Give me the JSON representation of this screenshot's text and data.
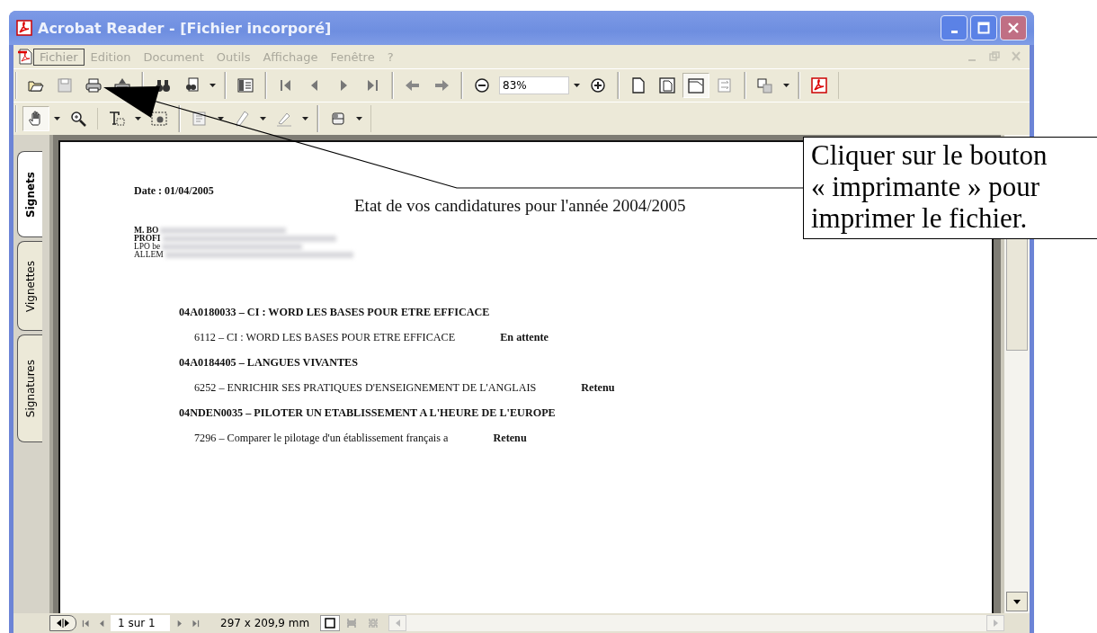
{
  "window": {
    "title": "Acrobat Reader - [Fichier incorporé]"
  },
  "menu": [
    {
      "label": "Fichier",
      "selected": true
    },
    {
      "label": "Edition",
      "selected": false
    },
    {
      "label": "Document",
      "selected": false
    },
    {
      "label": "Outils",
      "selected": false
    },
    {
      "label": "Affichage",
      "selected": false
    },
    {
      "label": "Fenêtre",
      "selected": false
    },
    {
      "label": "?",
      "selected": false
    }
  ],
  "zoom": {
    "value": "83%"
  },
  "page_layouts": [
    {
      "selected": false
    },
    {
      "selected": false
    },
    {
      "selected": true
    },
    {
      "selected": false
    }
  ],
  "tools": [
    {
      "selected": true
    },
    {
      "selected": false
    },
    {
      "selected": false
    },
    {
      "selected": false
    }
  ],
  "side_tabs": [
    {
      "label": "Signets",
      "selected": true
    },
    {
      "label": "Vignettes",
      "selected": false
    },
    {
      "label": "Signatures",
      "selected": false
    }
  ],
  "document": {
    "date": "Date : 01/04/2005",
    "title": "Etat de vos candidatures pour l'année 2004/2005",
    "address": [
      {
        "text": "M.  BO",
        "bold": true
      },
      {
        "text": "PROFI",
        "bold": true
      },
      {
        "text": "LPO be",
        "bold": false
      },
      {
        "text": "ALLEM",
        "bold": false
      }
    ],
    "sections": [
      {
        "heading": "04A0180033 – CI : WORD LES BASES POUR ETRE EFFICACE",
        "entry": "6112 – CI : WORD LES BASES POUR ETRE EFFICACE",
        "status": "En attente"
      },
      {
        "heading": "04A0184405 – LANGUES VIVANTES",
        "entry": "6252 – ENRICHIR SES PRATIQUES D'ENSEIGNEMENT DE L'ANGLAIS",
        "status": "Retenu"
      },
      {
        "heading": "04NDEN0035 – PILOTER UN ETABLISSEMENT A L'HEURE DE L'EUROPE",
        "entry": "7296 – Comparer le pilotage d'un établissement français a",
        "status": "Retenu"
      }
    ]
  },
  "status_bar": {
    "page": "1 sur 1",
    "size": "297 x 209,9 mm",
    "views": [
      {
        "selected": true
      },
      {
        "selected": false
      },
      {
        "selected": false
      }
    ]
  },
  "callout": {
    "text": "Cliquer sur le bouton « imprimante » pour imprimer le fichier."
  }
}
